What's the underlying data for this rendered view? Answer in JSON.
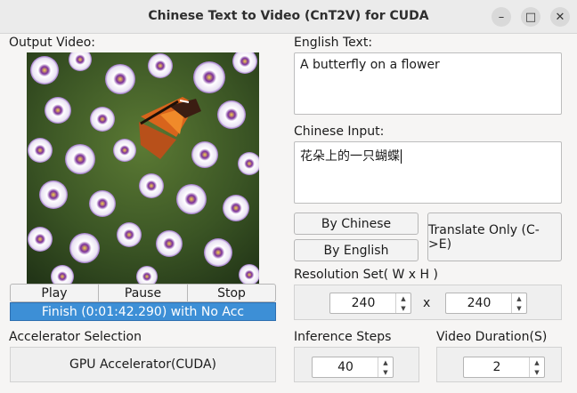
{
  "window": {
    "title": "Chinese Text to Video (CnT2V) for CUDA",
    "minimize_glyph": "–",
    "maximize_glyph": "□",
    "close_glyph": "✕"
  },
  "left": {
    "output_label": "Output Video:",
    "play_label": "Play",
    "pause_label": "Pause",
    "stop_label": "Stop",
    "status": "Finish (0:01:42.290) with No Acc",
    "accel_label": "Accelerator Selection",
    "accel_value": "GPU Accelerator(CUDA)"
  },
  "right": {
    "english_label": "English Text:",
    "english_value": "A butterfly on a flower",
    "chinese_label": "Chinese Input:",
    "chinese_value": "花朵上的一只蝴蝶",
    "by_chinese_label": "By Chinese",
    "by_english_label": "By English",
    "translate_label": "Translate Only (C->E)",
    "resolution_label": "Resolution Set( W x H )",
    "width_value": "240",
    "height_value": "240",
    "x_sep": "x",
    "steps_label": "Inference Steps",
    "steps_value": "40",
    "duration_label": "Video Duration(S)",
    "duration_value": "2"
  },
  "colors": {
    "accent": "#3d8fd6",
    "window_bg": "#f6f5f4"
  },
  "icons": {
    "spin_up": "up-arrow-icon",
    "spin_down": "down-arrow-icon"
  }
}
